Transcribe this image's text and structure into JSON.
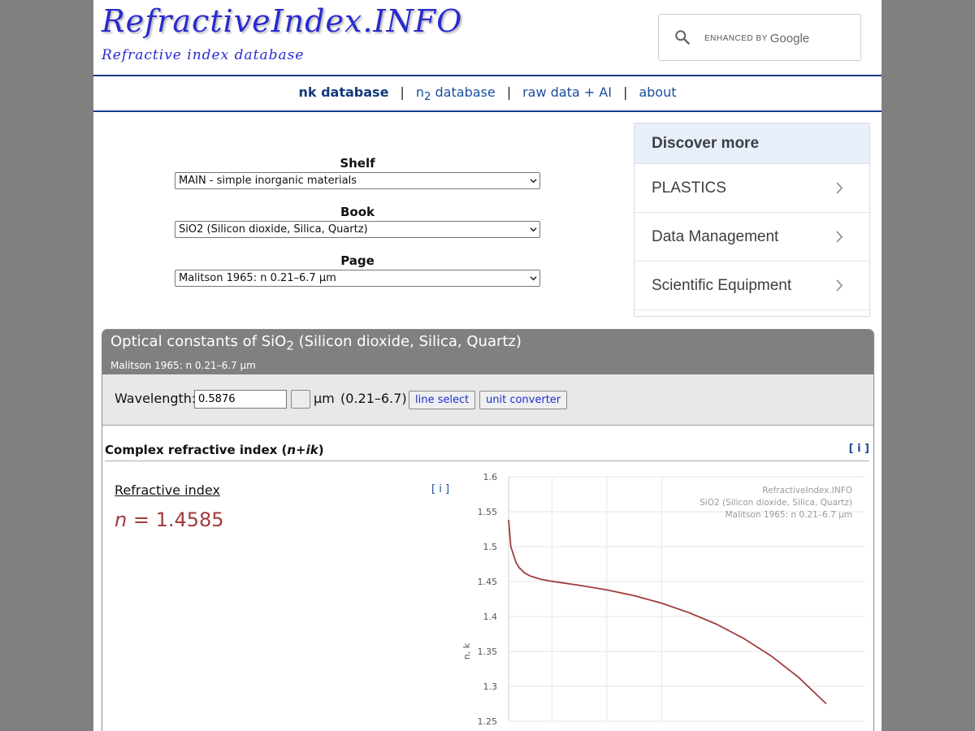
{
  "site": {
    "logo": "RefractiveIndex.INFO",
    "tagline": "Refractive index database",
    "search_placeholder": "ENHANCED BY",
    "search_brand": "Google"
  },
  "nav": {
    "items": [
      {
        "label": "nk database",
        "active": true
      },
      {
        "label": "n",
        "sub": "2",
        "rest": " database"
      },
      {
        "label": "raw data + AI"
      },
      {
        "label": "about"
      }
    ],
    "separator": "|"
  },
  "selectors": {
    "shelf": {
      "label": "Shelf",
      "value": "MAIN - simple inorganic materials"
    },
    "book": {
      "label": "Book",
      "value": "SiO2 (Silicon dioxide, Silica, Quartz)"
    },
    "page": {
      "label": "Page",
      "value": "Malitson 1965: n 0.21–6.7 µm"
    }
  },
  "ad": {
    "heading": "Discover more",
    "items": [
      "PLASTICS",
      "Data Management",
      "Scientific Equipment"
    ]
  },
  "optical": {
    "title_pre": "Optical constants of SiO",
    "title_sub": "2",
    "title_post": " (Silicon dioxide, Silica, Quartz)",
    "subtitle": "Malitson 1965: n 0.21–6.7 µm",
    "wavelength_label": "Wavelength:",
    "wavelength_value": "0.5876",
    "unit": "µm",
    "range": "(0.21–6.7)",
    "line_select": "line select",
    "unit_converter": "unit converter",
    "section_title_pre": "Complex refractive index (",
    "section_title_var": "n+ik",
    "section_title_post": ")",
    "info": "[ i ]",
    "ri_label": "Refractive index",
    "ri_info": "[ i ]",
    "ri_var": "n",
    "ri_value": " = 1.4585"
  },
  "chart_data": {
    "type": "line",
    "ylabel": "n, k",
    "yticks": [
      "1.6",
      "1.55",
      "1.5",
      "1.45",
      "1.4",
      "1.35",
      "1.3",
      "1.25"
    ],
    "watermark": [
      "RefractiveIndex.INFO",
      "SiO2 (Silicon dioxide, Silica, Quartz)",
      "Malitson 1965: n 0.21–6.7 µm"
    ],
    "series_color": "#a03c3c",
    "ylim": [
      1.25,
      1.6
    ],
    "xlim": [
      0.21,
      6.7
    ],
    "series": [
      {
        "x": [
          0.21,
          0.25,
          0.3,
          0.35,
          0.4,
          0.5,
          0.6,
          0.8,
          1.0,
          1.5,
          2.0,
          2.5,
          3.0,
          3.5,
          4.0,
          4.5,
          5.0,
          5.5,
          6.0
        ],
        "y": [
          1.5384,
          1.5,
          1.4878,
          1.4766,
          1.4701,
          1.4623,
          1.458,
          1.4533,
          1.4504,
          1.4446,
          1.4381,
          1.4298,
          1.4191,
          1.4055,
          1.3889,
          1.3685,
          1.3434,
          1.3127,
          1.2751
        ]
      }
    ]
  }
}
